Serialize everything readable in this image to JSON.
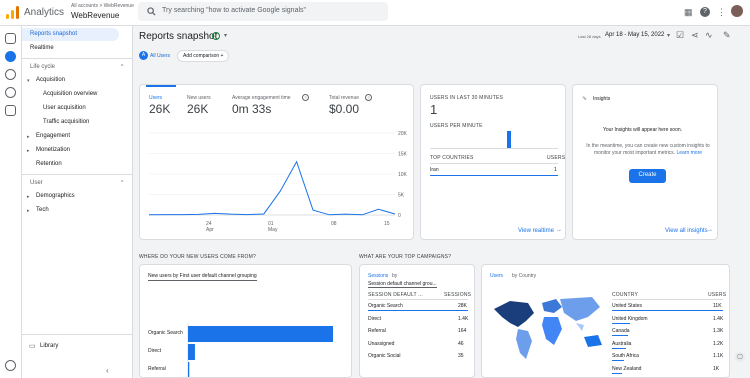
{
  "app": {
    "name": "Analytics",
    "accounts": "All accounts > WebRevenue",
    "property": "WebRevenue",
    "search_placeholder": "Try searching \"how to activate Google signals\""
  },
  "nav": {
    "reports_snapshot": "Reports snapshot",
    "realtime": "Realtime",
    "life_cycle": "Life cycle",
    "acquisition": "Acquisition",
    "acq_overview": "Acquisition overview",
    "user_acq": "User acquisition",
    "traffic_acq": "Traffic acquisition",
    "engagement": "Engagement",
    "monetization": "Monetization",
    "retention": "Retention",
    "user": "User",
    "demographics": "Demographics",
    "tech": "Tech",
    "library": "Library"
  },
  "header": {
    "title": "Reports snapshot",
    "all_users": "All Users",
    "add_comparison": "Add comparison +",
    "date_prefix": "Last 28 days",
    "date_range": "Apr 18 - May 15, 2022"
  },
  "metrics": {
    "users_label": "Users",
    "users": "26K",
    "new_users_label": "New users",
    "new_users": "26K",
    "engagement_label": "Average engagement time",
    "engagement": "0m 33s",
    "revenue_label": "Total revenue",
    "revenue": "$0.00"
  },
  "chart_data": {
    "type": "line",
    "x": [
      "Apr 18",
      "Apr 20",
      "Apr 22",
      "Apr 24",
      "Apr 26",
      "Apr 28",
      "Apr 30",
      "May 1",
      "May 3",
      "May 5",
      "May 7",
      "May 8",
      "May 9",
      "May 11",
      "May 13",
      "May 15"
    ],
    "y": [
      50,
      100,
      100,
      150,
      400,
      200,
      100,
      250,
      5800,
      13000,
      1200,
      50,
      200,
      50,
      1400,
      250
    ],
    "yticks": [
      "20K",
      "15K",
      "10K",
      "5K",
      "0"
    ],
    "xticks": [
      "24",
      "Apr",
      "01",
      "May",
      "08",
      "15"
    ],
    "ylim": [
      0,
      20000
    ]
  },
  "realtime": {
    "title": "USERS IN LAST 30 MINUTES",
    "value": "1",
    "per_minute": "USERS PER MINUTE",
    "countries_header": "TOP COUNTRIES",
    "users_header": "USERS",
    "country": "Iran",
    "country_users": "1",
    "link": "View realtime",
    "per_minute_values": [
      0,
      0,
      0,
      0,
      0,
      0,
      0,
      0,
      0,
      0,
      0,
      0,
      0,
      0,
      0,
      0,
      0,
      0,
      1,
      0,
      0,
      0,
      0,
      0,
      0,
      0,
      0,
      0,
      0,
      0
    ]
  },
  "insights": {
    "title": "Insights",
    "heading": "Your Insights will appear here soon.",
    "body": "In the meantime, you can create new custom insights to monitor your most important metrics.",
    "learn_more": "Learn more",
    "create": "Create",
    "link": "View all insights"
  },
  "new_users_card": {
    "title": "WHERE DO YOUR NEW USERS COME FROM?",
    "dropdown": "New users by First user default channel grouping",
    "categories": [
      "Organic Search",
      "Direct",
      "Referral",
      "Organic Social"
    ],
    "values": [
      23000,
      1100,
      200,
      30
    ]
  },
  "campaigns": {
    "title": "WHAT ARE YOUR TOP CAMPAIGNS?",
    "dropdown1": "Sessions",
    "dropdown2": "by",
    "dropdown3": "Session default channel grou...",
    "col1": "SESSION DEFAULT ...",
    "col2": "SESSIONS",
    "rows": [
      {
        "name": "Organic Search",
        "value": "28K"
      },
      {
        "name": "Direct",
        "value": "1.4K"
      },
      {
        "name": "Referral",
        "value": "164"
      },
      {
        "name": "Unassigned",
        "value": "46"
      },
      {
        "name": "Organic Social",
        "value": "35"
      }
    ]
  },
  "countries": {
    "dropdown": "Users",
    "by": "by Country",
    "col1": "COUNTRY",
    "col2": "USERS",
    "rows": [
      {
        "name": "United States",
        "value": "11K"
      },
      {
        "name": "United Kingdom",
        "value": "1.4K"
      },
      {
        "name": "Canada",
        "value": "1.3K"
      },
      {
        "name": "Australia",
        "value": "1.2K"
      },
      {
        "name": "South Africa",
        "value": "1.1K"
      },
      {
        "name": "New Zealand",
        "value": "1K"
      }
    ]
  },
  "colors": {
    "primary": "#1a73e8",
    "active_bg": "#e8f0fe",
    "map_dark": "#1a3d7c",
    "map_light": "#a8c7fa"
  }
}
